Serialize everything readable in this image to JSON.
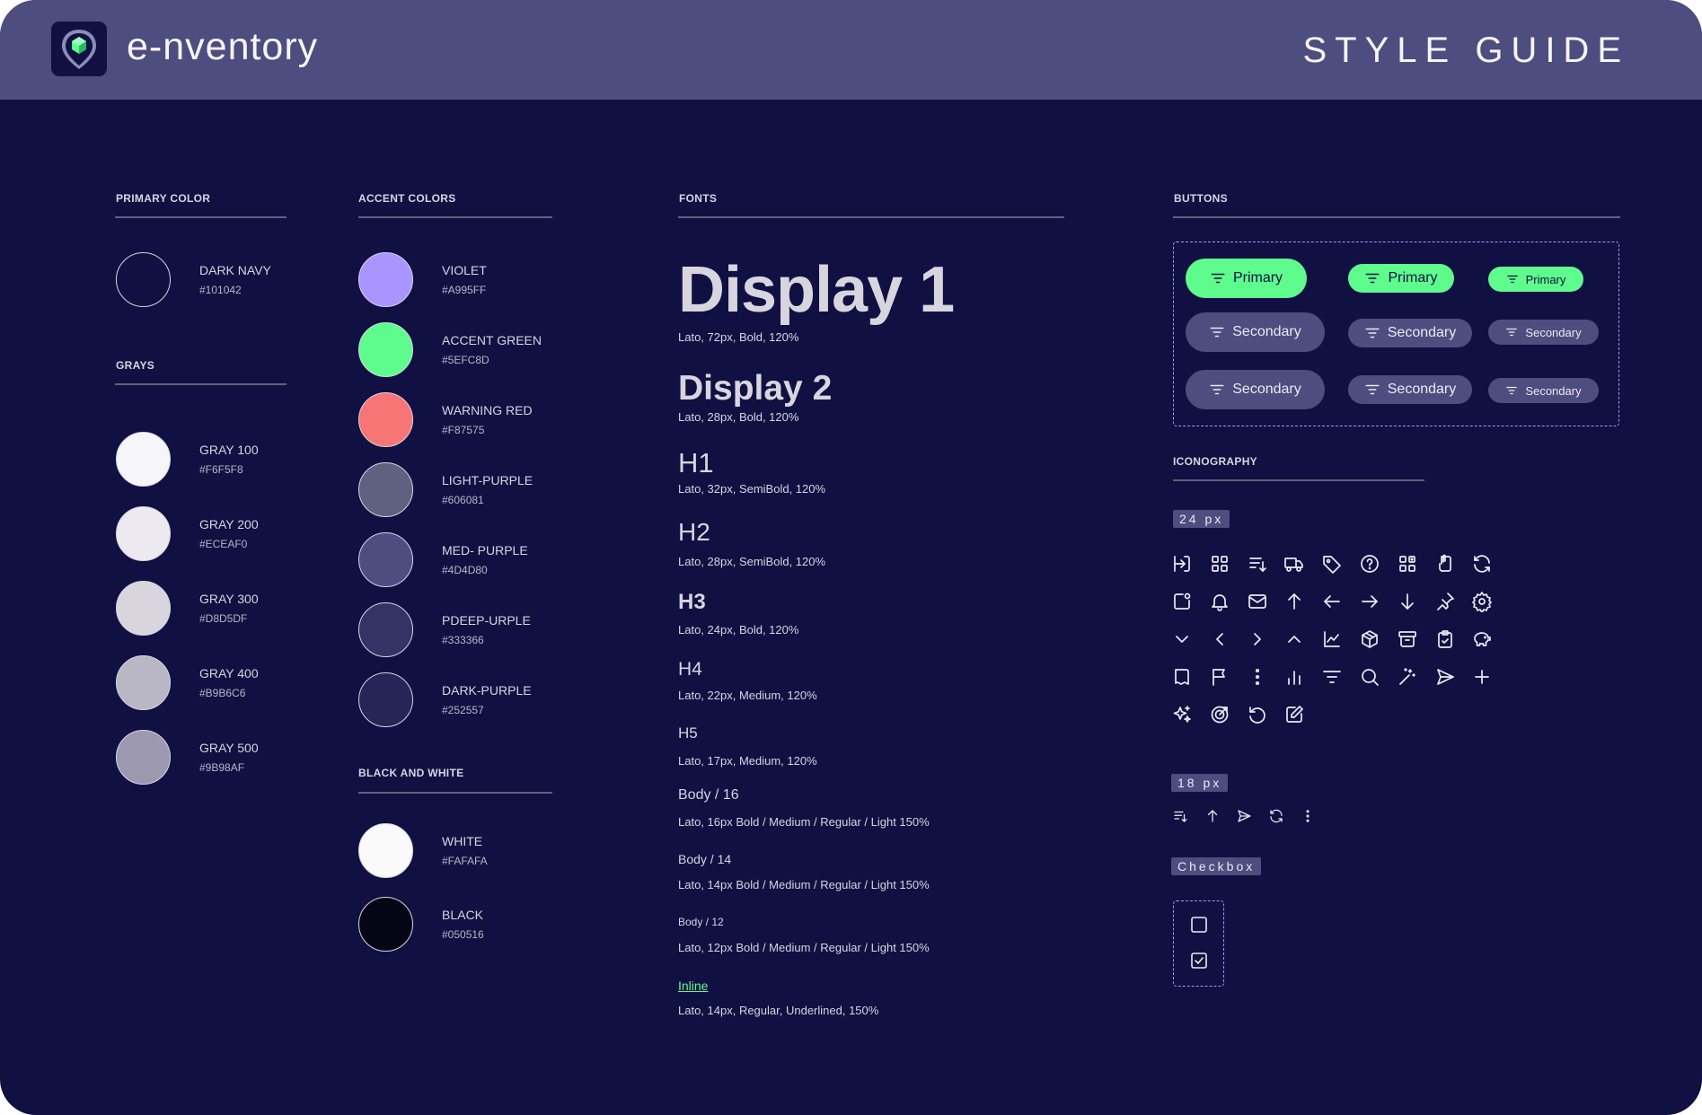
{
  "header": {
    "brand": "e-nventory",
    "title": "STYLE GUIDE"
  },
  "primary_color": {
    "label": "PRIMARY COLOR",
    "swatches": [
      {
        "name": "DARK NAVY",
        "hex": "#101042",
        "color": "#101042"
      }
    ]
  },
  "grays": {
    "label": "GRAYS",
    "swatches": [
      {
        "name": "GRAY 100",
        "hex": "#F6F5F8",
        "color": "#F6F5F8"
      },
      {
        "name": "GRAY 200",
        "hex": "#ECEAF0",
        "color": "#ECEAF0"
      },
      {
        "name": "GRAY 300",
        "hex": "#D8D5DF",
        "color": "#D8D5DF"
      },
      {
        "name": "GRAY 400",
        "hex": "#B9B6C6",
        "color": "#B9B6C6"
      },
      {
        "name": "GRAY 500",
        "hex": "#9B98AF",
        "color": "#9B98AF"
      }
    ]
  },
  "accent_colors": {
    "label": "ACCENT COLORS",
    "swatches": [
      {
        "name": "VIOLET",
        "hex": "#A995FF",
        "color": "#A995FF"
      },
      {
        "name": "ACCENT GREEN",
        "hex": "#5EFC8D",
        "color": "#5EFC8D"
      },
      {
        "name": "WARNING RED",
        "hex": "#F87575",
        "color": "#F87575"
      },
      {
        "name": "LIGHT-PURPLE",
        "hex": "#606081",
        "color": "#606081"
      },
      {
        "name": "MED- PURPLE",
        "hex": "#4D4D80",
        "color": "#4D4D80"
      },
      {
        "name": "PDEEP-URPLE",
        "hex": "#333366",
        "color": "#333366"
      },
      {
        "name": "DARK-PURPLE",
        "hex": "#252557",
        "color": "#252557"
      }
    ]
  },
  "black_white": {
    "label": "BLACK AND WHITE",
    "swatches": [
      {
        "name": "WHITE",
        "hex": "#FAFAFA",
        "color": "#FAFAFA"
      },
      {
        "name": "BLACK",
        "hex": "#050516",
        "color": "#050516"
      }
    ]
  },
  "fonts": {
    "label": "FONTS",
    "items": [
      {
        "sample": "Display 1",
        "spec": "Lato, 72px, Bold, 120%"
      },
      {
        "sample": "Display 2",
        "spec": "Lato, 28px, Bold, 120%"
      },
      {
        "sample": "H1",
        "spec": "Lato, 32px, SemiBold, 120%"
      },
      {
        "sample": "H2",
        "spec": "Lato, 28px, SemiBold, 120%"
      },
      {
        "sample": "H3",
        "spec": "Lato, 24px, Bold, 120%"
      },
      {
        "sample": "H4",
        "spec": "Lato, 22px, Medium, 120%"
      },
      {
        "sample": "H5",
        "spec": "Lato, 17px, Medium, 120%"
      },
      {
        "sample": "Body / 16",
        "spec": "Lato, 16px Bold / Medium / Regular / Light 150%"
      },
      {
        "sample": "Body / 14",
        "spec": "Lato, 14px Bold / Medium / Regular  / Light 150%"
      },
      {
        "sample": "Body / 12",
        "spec": "Lato, 12px Bold / Medium / Regular / Light 150%"
      },
      {
        "sample": "Inline",
        "spec": "Lato, 14px, Regular, Underlined, 150%"
      }
    ]
  },
  "buttons": {
    "label": "BUTTONS",
    "primary_label": "Primary",
    "secondary_label": "Secondary",
    "icon": "filter-icon"
  },
  "iconography": {
    "label": "ICONOGRAPHY",
    "size_24_label": "24 px",
    "size_18_label": "18 px",
    "icons_24": [
      "logout-icon",
      "grid-icon",
      "sort-list-icon",
      "truck-icon",
      "tag-icon",
      "help-circle-icon",
      "widgets-icon",
      "clipboard-hand-icon",
      "refresh-icon",
      "notification-square-icon",
      "bell-icon",
      "mail-icon",
      "arrow-up-icon",
      "arrow-left-icon",
      "arrow-right-icon",
      "arrow-down-icon",
      "pin-icon",
      "settings-icon",
      "chevron-down-icon",
      "chevron-left-icon",
      "chevron-right-icon",
      "chevron-up-icon",
      "line-chart-icon",
      "box-icon",
      "archive-icon",
      "clipboard-check-icon",
      "piggy-bank-icon",
      "book-icon",
      "flag-icon",
      "more-vertical-icon",
      "bar-chart-icon",
      "filter-icon",
      "search-icon",
      "magic-wand-icon",
      "send-icon",
      "plus-icon",
      "sparkles-icon",
      "target-icon",
      "undo-icon",
      "edit-icon"
    ],
    "icons_18": [
      "sort-list-icon",
      "arrow-up-icon",
      "send-icon",
      "refresh-icon",
      "more-vertical-icon"
    ]
  },
  "checkbox": {
    "label": "Checkbox",
    "states": [
      {
        "checked": false
      },
      {
        "checked": true
      }
    ]
  },
  "colors": {
    "background": "#101042",
    "header": "#4D4D80",
    "accent": "#5EFC8D",
    "violet": "#A995FF"
  }
}
